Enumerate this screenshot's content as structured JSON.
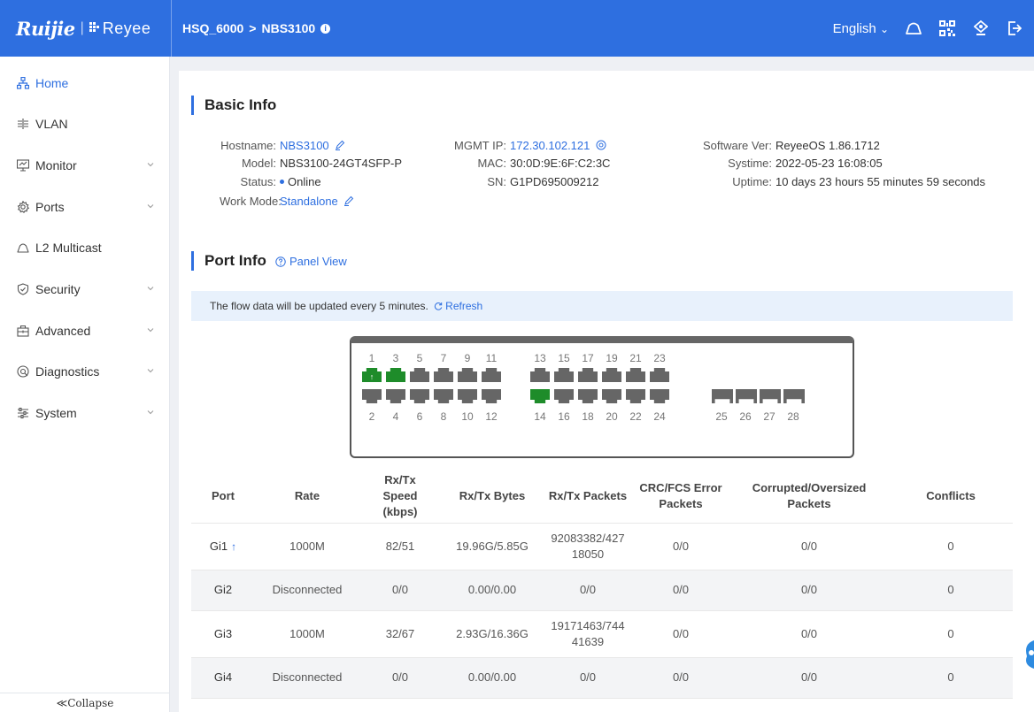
{
  "header": {
    "brand": "Ruijie",
    "brand_sep": "|",
    "brand_reyee": "Reyee",
    "breadcrumb_site": "HSQ_6000",
    "breadcrumb_arrow": ">",
    "breadcrumb_device": "NBS3100",
    "info_mark": "i",
    "language": "English",
    "language_chevron": "⌄"
  },
  "sidebar": {
    "items": [
      {
        "label": "Home",
        "icon": "topology-icon",
        "expandable": false
      },
      {
        "label": "VLAN",
        "icon": "vlan-icon",
        "expandable": false
      },
      {
        "label": "Monitor",
        "icon": "monitor-icon",
        "expandable": true
      },
      {
        "label": "Ports",
        "icon": "gear-icon",
        "expandable": true
      },
      {
        "label": "L2 Multicast",
        "icon": "cloud-icon",
        "expandable": false
      },
      {
        "label": "Security",
        "icon": "shield-icon",
        "expandable": true
      },
      {
        "label": "Advanced",
        "icon": "toolbox-icon",
        "expandable": true
      },
      {
        "label": "Diagnostics",
        "icon": "diagnostics-icon",
        "expandable": true
      },
      {
        "label": "System",
        "icon": "sliders-icon",
        "expandable": true
      }
    ],
    "collapse_label": "≪Collapse"
  },
  "basic_info": {
    "title": "Basic Info",
    "hostname_label": "Hostname:",
    "hostname": "NBS3100",
    "model_label": "Model:",
    "model": "NBS3100-24GT4SFP-P",
    "status_label": "Status:",
    "status": "Online",
    "work_mode_label": "Work Mode:",
    "work_mode": "Standalone",
    "mgmt_ip_label": "MGMT IP:",
    "mgmt_ip": "172.30.102.121",
    "mac_label": "MAC:",
    "mac": "30:0D:9E:6F:C2:3C",
    "sn_label": "SN:",
    "sn": "G1PD695009212",
    "software_label": "Software Ver:",
    "software": "ReyeeOS 1.86.1712",
    "systime_label": "Systime:",
    "systime": "2022-05-23 16:08:05",
    "uptime_label": "Uptime:",
    "uptime": "10 days 23 hours 55 minutes 59 seconds"
  },
  "port_info": {
    "title": "Port Info",
    "panel_view": "Panel View",
    "notice": "The flow data will be updated every 5 minutes.",
    "refresh": "Refresh",
    "top_numbers": [
      "1",
      "3",
      "5",
      "7",
      "9",
      "11",
      "13",
      "15",
      "17",
      "19",
      "21",
      "23"
    ],
    "bottom_numbers": [
      "2",
      "4",
      "6",
      "8",
      "10",
      "12",
      "14",
      "16",
      "18",
      "20",
      "22",
      "24",
      "25",
      "26",
      "27",
      "28"
    ],
    "ports_up": [
      "1",
      "3",
      "14"
    ],
    "uplink_port": "1",
    "uplink_symbol": "↑"
  },
  "table": {
    "headers": [
      "Port",
      "Rate",
      "Rx/Tx Speed (kbps)",
      "Rx/Tx Bytes",
      "Rx/Tx Packets",
      "CRC/FCS Error Packets",
      "Corrupted/Oversized Packets",
      "Conflicts"
    ],
    "rows": [
      {
        "port": "Gi1",
        "uplink": "↑",
        "rate": "1000M",
        "speed": "82/51",
        "bytes": "19.96G/5.85G",
        "packets": "92083382/42718050",
        "crc": "0/0",
        "corrupted": "0/0",
        "conflicts": "0"
      },
      {
        "port": "Gi2",
        "uplink": "",
        "rate": "Disconnected",
        "speed": "0/0",
        "bytes": "0.00/0.00",
        "packets": "0/0",
        "crc": "0/0",
        "corrupted": "0/0",
        "conflicts": "0"
      },
      {
        "port": "Gi3",
        "uplink": "",
        "rate": "1000M",
        "speed": "32/67",
        "bytes": "2.93G/16.36G",
        "packets": "19171463/74441639",
        "crc": "0/0",
        "corrupted": "0/0",
        "conflicts": "0"
      },
      {
        "port": "Gi4",
        "uplink": "",
        "rate": "Disconnected",
        "speed": "0/0",
        "bytes": "0.00/0.00",
        "packets": "0/0",
        "crc": "0/0",
        "corrupted": "0/0",
        "conflicts": "0"
      }
    ]
  },
  "colors": {
    "accent": "#2e6fe0",
    "link_up": "#1a9a32",
    "port_up": "#1e8c2a",
    "port_down": "#666666"
  }
}
